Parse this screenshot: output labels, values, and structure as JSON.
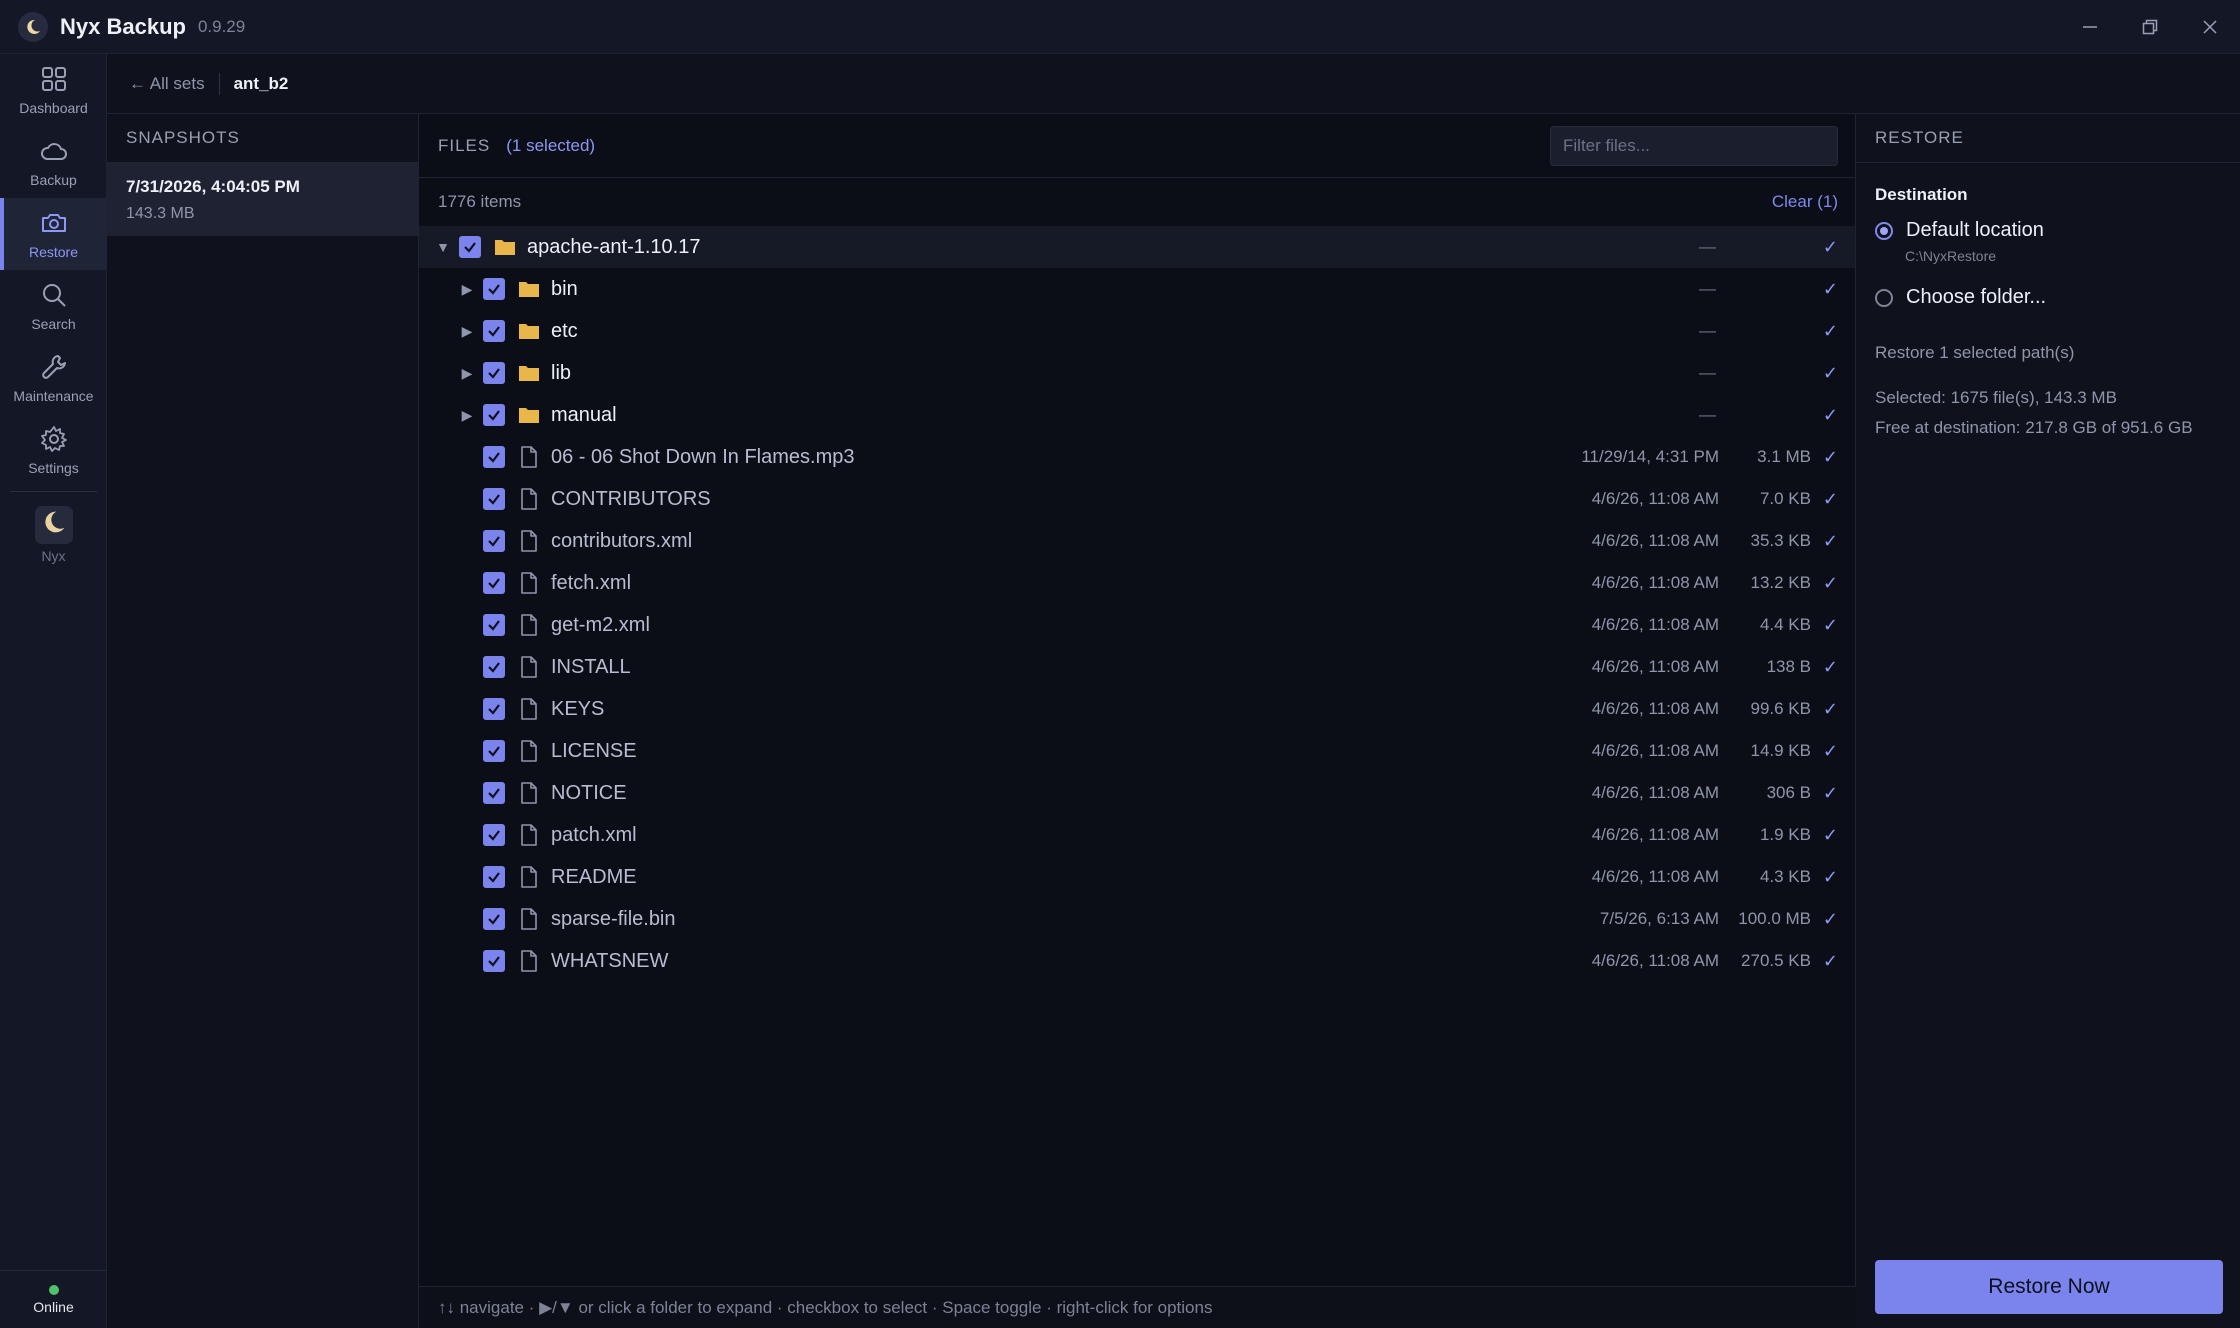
{
  "app": {
    "title": "Nyx Backup",
    "version": "0.9.29"
  },
  "window": {
    "minimize_icon": "minimize-icon",
    "restore_icon": "restore-window-icon",
    "close_icon": "close-icon"
  },
  "rail": {
    "items": [
      {
        "label": "Dashboard",
        "icon": "dashboard-grid-icon",
        "active": false
      },
      {
        "label": "Backup",
        "icon": "cloud-icon",
        "active": false
      },
      {
        "label": "Restore",
        "icon": "camera-icon",
        "active": true
      },
      {
        "label": "Search",
        "icon": "search-icon",
        "active": false
      },
      {
        "label": "Maintenance",
        "icon": "wrench-icon",
        "active": false
      },
      {
        "label": "Settings",
        "icon": "gear-icon",
        "active": false
      }
    ],
    "nyx_label": "Nyx",
    "status": "Online"
  },
  "breadcrumb": {
    "back": "← All sets",
    "current": "ant_b2"
  },
  "snapshots": {
    "title": "SNAPSHOTS",
    "items": [
      {
        "date": "7/31/2026, 4:04:05 PM",
        "size": "143.3 MB"
      }
    ]
  },
  "files": {
    "title": "FILES",
    "selected": "(1 selected)",
    "filter_placeholder": "Filter files...",
    "items_count": "1776 items",
    "clear": "Clear (1)",
    "dash": "—",
    "check": "✓",
    "rows": [
      {
        "name": "apache-ant-1.10.17",
        "type": "folder",
        "expanded": true,
        "level": 0,
        "date": "",
        "size": ""
      },
      {
        "name": "bin",
        "type": "folder",
        "expanded": false,
        "level": 1,
        "date": "",
        "size": ""
      },
      {
        "name": "etc",
        "type": "folder",
        "expanded": false,
        "level": 1,
        "date": "",
        "size": ""
      },
      {
        "name": "lib",
        "type": "folder",
        "expanded": false,
        "level": 1,
        "date": "",
        "size": ""
      },
      {
        "name": "manual",
        "type": "folder",
        "expanded": false,
        "level": 1,
        "date": "",
        "size": ""
      },
      {
        "name": "06 - 06 Shot Down In Flames.mp3",
        "type": "file",
        "level": 1,
        "date": "11/29/14, 4:31 PM",
        "size": "3.1 MB"
      },
      {
        "name": "CONTRIBUTORS",
        "type": "file",
        "level": 1,
        "date": "4/6/26, 11:08 AM",
        "size": "7.0 KB"
      },
      {
        "name": "contributors.xml",
        "type": "file",
        "level": 1,
        "date": "4/6/26, 11:08 AM",
        "size": "35.3 KB"
      },
      {
        "name": "fetch.xml",
        "type": "file",
        "level": 1,
        "date": "4/6/26, 11:08 AM",
        "size": "13.2 KB"
      },
      {
        "name": "get-m2.xml",
        "type": "file",
        "level": 1,
        "date": "4/6/26, 11:08 AM",
        "size": "4.4 KB"
      },
      {
        "name": "INSTALL",
        "type": "file",
        "level": 1,
        "date": "4/6/26, 11:08 AM",
        "size": "138 B"
      },
      {
        "name": "KEYS",
        "type": "file",
        "level": 1,
        "date": "4/6/26, 11:08 AM",
        "size": "99.6 KB"
      },
      {
        "name": "LICENSE",
        "type": "file",
        "level": 1,
        "date": "4/6/26, 11:08 AM",
        "size": "14.9 KB"
      },
      {
        "name": "NOTICE",
        "type": "file",
        "level": 1,
        "date": "4/6/26, 11:08 AM",
        "size": "306 B"
      },
      {
        "name": "patch.xml",
        "type": "file",
        "level": 1,
        "date": "4/6/26, 11:08 AM",
        "size": "1.9 KB"
      },
      {
        "name": "README",
        "type": "file",
        "level": 1,
        "date": "4/6/26, 11:08 AM",
        "size": "4.3 KB"
      },
      {
        "name": "sparse-file.bin",
        "type": "file",
        "level": 1,
        "date": "7/5/26, 6:13 AM",
        "size": "100.0 MB"
      },
      {
        "name": "WHATSNEW",
        "type": "file",
        "level": 1,
        "date": "4/6/26, 11:08 AM",
        "size": "270.5 KB"
      }
    ],
    "footer": "↑↓ navigate · ▶/▼ or click a folder to expand · checkbox to select · Space toggle · right-click for options"
  },
  "restore": {
    "title": "RESTORE",
    "destination_label": "Destination",
    "default_option": "Default location",
    "default_path": "C:\\NyxRestore",
    "choose_option": "Choose folder...",
    "note": "Restore 1 selected path(s)",
    "selected_stat": "Selected: 1675 file(s), 143.3 MB",
    "free_stat": "Free at destination: 217.8 GB of 951.6 GB",
    "button": "Restore Now"
  },
  "colors": {
    "accent": "#7b84ec",
    "folder": "#e9b64a",
    "online": "#4fc26b"
  }
}
